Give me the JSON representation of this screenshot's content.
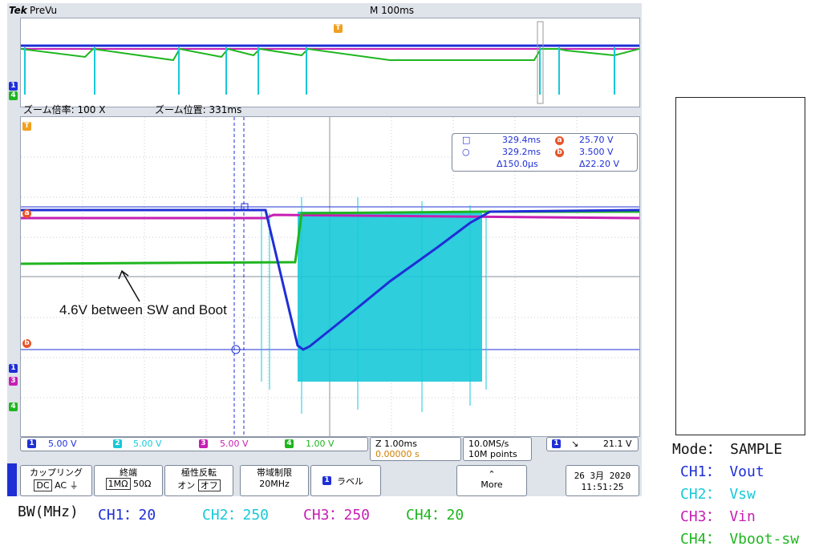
{
  "header": {
    "brand": "Tek",
    "mode": "PreVu",
    "timebase": "M 100ms"
  },
  "zoom": {
    "factor_label": "ズーム倍率: 100 X",
    "position_label": "ズーム位置: 331ms"
  },
  "markers": {
    "trigger": "T",
    "cursor_a": "a",
    "cursor_b": "b",
    "ch1": "1",
    "ch3": "3",
    "ch4": "4"
  },
  "cursor_readout": {
    "t1": "329.4ms",
    "v_a": "25.70 V",
    "t2": "329.2ms",
    "v_b": "3.500 V",
    "dt": "Δ150.0μs",
    "dv": "Δ22.20 V"
  },
  "annotation": "4.6V between SW and Boot",
  "channels": [
    {
      "num": "1",
      "scale": "5.00 V",
      "color": "#1f2fd6"
    },
    {
      "num": "2",
      "scale": "5.00 V",
      "color": "#17c9d9"
    },
    {
      "num": "3",
      "scale": "5.00 V",
      "color": "#c61fb3"
    },
    {
      "num": "4",
      "scale": "1.00 V",
      "color": "#1fb51f"
    }
  ],
  "horizontal": {
    "scale": "Z 1.00ms",
    "delay": "0.00000 s"
  },
  "acquisition": {
    "rate": "10.0MS/s",
    "points": "10M points"
  },
  "trigger": {
    "channel": "1",
    "slope": "↘",
    "level": "21.1 V"
  },
  "menu": {
    "coupling": {
      "title": "カップリング",
      "options": [
        "DC",
        "AC",
        "⏚"
      ]
    },
    "termination": {
      "title": "終端",
      "options": [
        "1MΩ",
        "50Ω"
      ]
    },
    "invert": {
      "title": "極性反転",
      "options": [
        "オン",
        "オフ"
      ]
    },
    "bandwidth": {
      "title": "帯域制限",
      "value": "20MHz"
    },
    "label": {
      "num": "1",
      "title": "ラベル"
    },
    "more": "More"
  },
  "datetime": {
    "date": "26 3月 2020",
    "time": "11:51:25"
  },
  "legend": {
    "mode": "Mode： SAMPLE",
    "ch1": "CH1： Vout",
    "ch2": "CH2： Vsw",
    "ch3": "CH3： Vin",
    "ch4": "CH4： Vboot-sw"
  },
  "bandwidth_row": {
    "label": "BW(MHz)",
    "ch1": "CH1：20",
    "ch2": "CH2：250",
    "ch3": "CH3：250",
    "ch4": "CH4：20"
  }
}
